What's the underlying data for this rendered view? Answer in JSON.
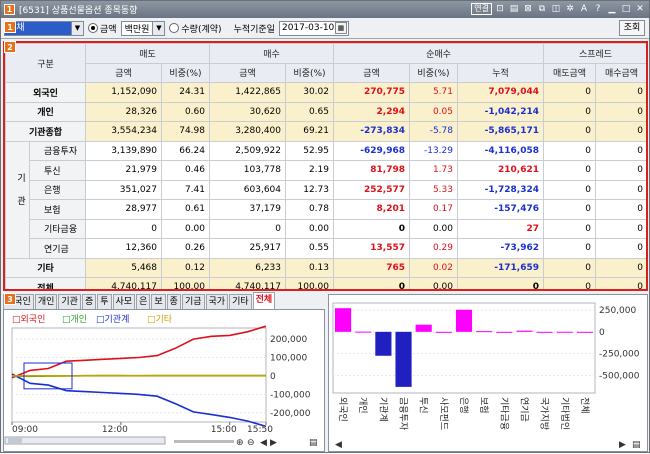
{
  "window": {
    "badge": "1",
    "title": "[6531] 상품선물옵션 종목동향",
    "link_label": "연결",
    "help_label": "?"
  },
  "toolbar": {
    "instrument": "국채",
    "radio_amount": "금액",
    "unit": "백만원",
    "radio_qty": "수량(계약)",
    "date_label": "누적기준일",
    "date": "2017-03-10",
    "query": "조회"
  },
  "sections": {
    "s1": "1",
    "s2": "2",
    "s3": "3"
  },
  "table": {
    "headers": {
      "gubun": "구분",
      "sell": "매도",
      "buy": "매수",
      "net": "순매수",
      "spread": "스프레드",
      "amt": "금액",
      "ratio": "비중(%)",
      "cum": "누적",
      "sp_sell": "매도금액",
      "sp_buy": "매수금액"
    },
    "group_label": "기관",
    "rows": [
      {
        "label": "외국인",
        "type": "main",
        "sell": "1,152,090",
        "sell_r": "24.31",
        "buy": "1,422,865",
        "buy_r": "30.02",
        "net": "270,775",
        "net_c": "red",
        "net_r": "5.71",
        "net_rc": "red",
        "cum": "7,079,044",
        "cum_c": "red",
        "sp_s": "0",
        "sp_b": "0"
      },
      {
        "label": "개인",
        "type": "main",
        "sell": "28,326",
        "sell_r": "0.60",
        "buy": "30,620",
        "buy_r": "0.65",
        "net": "2,294",
        "net_c": "red",
        "net_r": "0.05",
        "net_rc": "red",
        "cum": "-1,042,214",
        "cum_c": "blu",
        "sp_s": "0",
        "sp_b": "0"
      },
      {
        "label": "기관종합",
        "type": "main",
        "sell": "3,554,234",
        "sell_r": "74.98",
        "buy": "3,280,400",
        "buy_r": "69.21",
        "net": "-273,834",
        "net_c": "blu",
        "net_r": "-5.78",
        "net_rc": "blu",
        "cum": "-5,865,171",
        "cum_c": "blu",
        "sp_s": "0",
        "sp_b": "0"
      },
      {
        "label": "금융투자",
        "type": "sub",
        "sell": "3,139,890",
        "sell_r": "66.24",
        "buy": "2,509,922",
        "buy_r": "52.95",
        "net": "-629,968",
        "net_c": "blu",
        "net_r": "-13.29",
        "net_rc": "blu",
        "cum": "-4,116,058",
        "cum_c": "blu",
        "sp_s": "0",
        "sp_b": "0"
      },
      {
        "label": "투신",
        "type": "sub",
        "sell": "21,979",
        "sell_r": "0.46",
        "buy": "103,778",
        "buy_r": "2.19",
        "net": "81,798",
        "net_c": "red",
        "net_r": "1.73",
        "net_rc": "red",
        "cum": "210,621",
        "cum_c": "red",
        "sp_s": "0",
        "sp_b": "0"
      },
      {
        "label": "은행",
        "type": "sub",
        "sell": "351,027",
        "sell_r": "7.41",
        "buy": "603,604",
        "buy_r": "12.73",
        "net": "252,577",
        "net_c": "red",
        "net_r": "5.33",
        "net_rc": "red",
        "cum": "-1,728,324",
        "cum_c": "blu",
        "sp_s": "0",
        "sp_b": "0"
      },
      {
        "label": "보험",
        "type": "sub",
        "sell": "28,977",
        "sell_r": "0.61",
        "buy": "37,179",
        "buy_r": "0.78",
        "net": "8,201",
        "net_c": "red",
        "net_r": "0.17",
        "net_rc": "red",
        "cum": "-157,476",
        "cum_c": "blu",
        "sp_s": "0",
        "sp_b": "0"
      },
      {
        "label": "기타금융",
        "type": "sub",
        "sell": "0",
        "sell_r": "0.00",
        "buy": "0",
        "buy_r": "0.00",
        "net": "0",
        "net_c": "",
        "net_r": "0.00",
        "net_rc": "",
        "cum": "27",
        "cum_c": "red",
        "sp_s": "0",
        "sp_b": "0"
      },
      {
        "label": "연기금",
        "type": "sub",
        "sell": "12,360",
        "sell_r": "0.26",
        "buy": "25,917",
        "buy_r": "0.55",
        "net": "13,557",
        "net_c": "red",
        "net_r": "0.29",
        "net_rc": "red",
        "cum": "-73,962",
        "cum_c": "blu",
        "sp_s": "0",
        "sp_b": "0"
      },
      {
        "label": "기타",
        "type": "main",
        "sell": "5,468",
        "sell_r": "0.12",
        "buy": "6,233",
        "buy_r": "0.13",
        "net": "765",
        "net_c": "red",
        "net_r": "0.02",
        "net_rc": "red",
        "cum": "-171,659",
        "cum_c": "blu",
        "sp_s": "0",
        "sp_b": "0"
      },
      {
        "label": "전체",
        "type": "main",
        "sell": "4,740,117",
        "sell_r": "100.00",
        "buy": "4,740,117",
        "buy_r": "100.00",
        "net": "0",
        "net_c": "",
        "net_r": "0.00",
        "net_rc": "",
        "cum": "0",
        "cum_c": "",
        "sp_s": "0",
        "sp_b": "0"
      }
    ]
  },
  "tabs": [
    "외국인",
    "개인",
    "기관",
    "증",
    "투",
    "사모",
    "은",
    "보",
    "종",
    "기금",
    "국가",
    "기타",
    "전체"
  ],
  "active_tab": "전체",
  "colors": {
    "foreign": "#e0101a",
    "individual": "#2aa02a",
    "institution": "#1a2fd0",
    "other": "#c8a000",
    "bar": "#ff00ff",
    "bar_neg": "#2020c0"
  },
  "chart_data": [
    {
      "type": "line",
      "legend": [
        "외국인",
        "개인",
        "기관계",
        "기타"
      ],
      "x_ticks": [
        "09:00",
        "12:00",
        "15:00",
        "15:50"
      ],
      "y_ticks": [
        200000,
        100000,
        0,
        -100000,
        -200000
      ],
      "y_tick_labels": [
        "200,000",
        "100,000",
        "0",
        "-100,000",
        "-200,000"
      ],
      "ylim": [
        -250000,
        260000
      ],
      "x": [
        "09:00",
        "09:30",
        "10:00",
        "10:30",
        "11:00",
        "11:30",
        "12:00",
        "12:30",
        "13:00",
        "13:30",
        "14:00",
        "14:30",
        "15:00",
        "15:30",
        "15:50"
      ],
      "series": [
        {
          "name": "외국인",
          "values": [
            -10000,
            30000,
            40000,
            80000,
            85000,
            90000,
            95000,
            100000,
            110000,
            150000,
            200000,
            215000,
            220000,
            240000,
            270000
          ]
        },
        {
          "name": "개인",
          "values": [
            0,
            -2000,
            -1000,
            0,
            1000,
            2000,
            2000,
            1000,
            1500,
            2000,
            2500,
            2000,
            2000,
            2300,
            2294
          ]
        },
        {
          "name": "기관계",
          "values": [
            10000,
            -40000,
            -50000,
            -80000,
            -85000,
            -90000,
            -95000,
            -100000,
            -110000,
            -150000,
            -195000,
            -210000,
            -225000,
            -245000,
            -273834
          ]
        },
        {
          "name": "기타",
          "values": [
            0,
            500,
            600,
            700,
            700,
            650,
            700,
            750,
            700,
            720,
            740,
            750,
            760,
            765,
            765
          ]
        }
      ]
    },
    {
      "type": "bar",
      "categories": [
        "외국인",
        "개인",
        "기관계",
        "금융투자",
        "투신",
        "사모펀드",
        "은행",
        "보험",
        "기타금융",
        "연기금",
        "국가지방",
        "기타법인",
        "전체"
      ],
      "values": [
        270775,
        2294,
        -273834,
        -629968,
        81798,
        0,
        252577,
        8201,
        0,
        13557,
        0,
        765,
        0
      ],
      "y_ticks": [
        250000,
        0,
        -250000,
        -500000
      ],
      "y_tick_labels": [
        "250,000",
        "0",
        "-250,000",
        "-500,000"
      ],
      "ylim": [
        -700000,
        330000
      ]
    }
  ]
}
